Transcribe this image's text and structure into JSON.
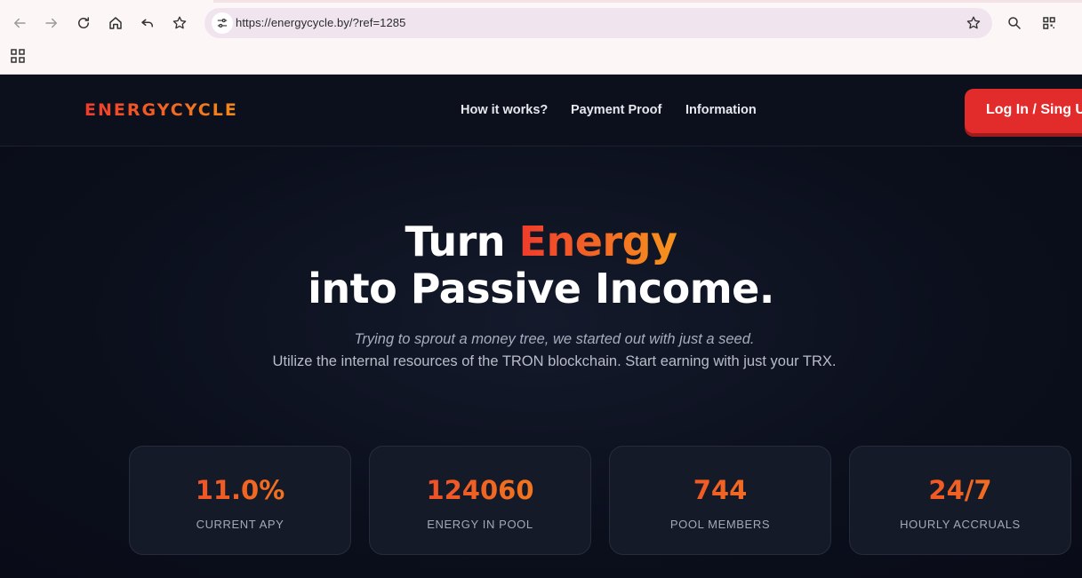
{
  "browser": {
    "url": "https://energycycle.by/?ref=1285",
    "icons": [
      "back-icon",
      "forward-icon",
      "reload-icon",
      "home-icon",
      "undo-icon",
      "bookmark-star-icon",
      "site-info-icon",
      "search-icon",
      "qr-code-icon",
      "apps-grid-icon"
    ]
  },
  "header": {
    "logo": "ENERGYCYCLE",
    "nav": [
      "How it works?",
      "Payment Proof",
      "Information"
    ],
    "login_label": "Log In / Sing Up"
  },
  "hero": {
    "title_part1": "Turn ",
    "title_accent": "Energy",
    "title_line2": "into Passive Income.",
    "tagline": "Trying to sprout a money tree, we started out with just a seed.",
    "description": "Utilize the internal resources of the TRON blockchain. Start earning with just your TRX."
  },
  "stats": [
    {
      "value": "11.0%",
      "label": "CURRENT APY"
    },
    {
      "value": "124060",
      "label": "ENERGY IN POOL"
    },
    {
      "value": "744",
      "label": "POOL MEMBERS"
    },
    {
      "value": "24/7",
      "label": "HOURLY ACCRUALS"
    }
  ],
  "colors": {
    "accent_red": "#ef3b2c",
    "accent_orange": "#f28a1a",
    "background": "#0a0e1a",
    "button": "#e22b2b"
  }
}
